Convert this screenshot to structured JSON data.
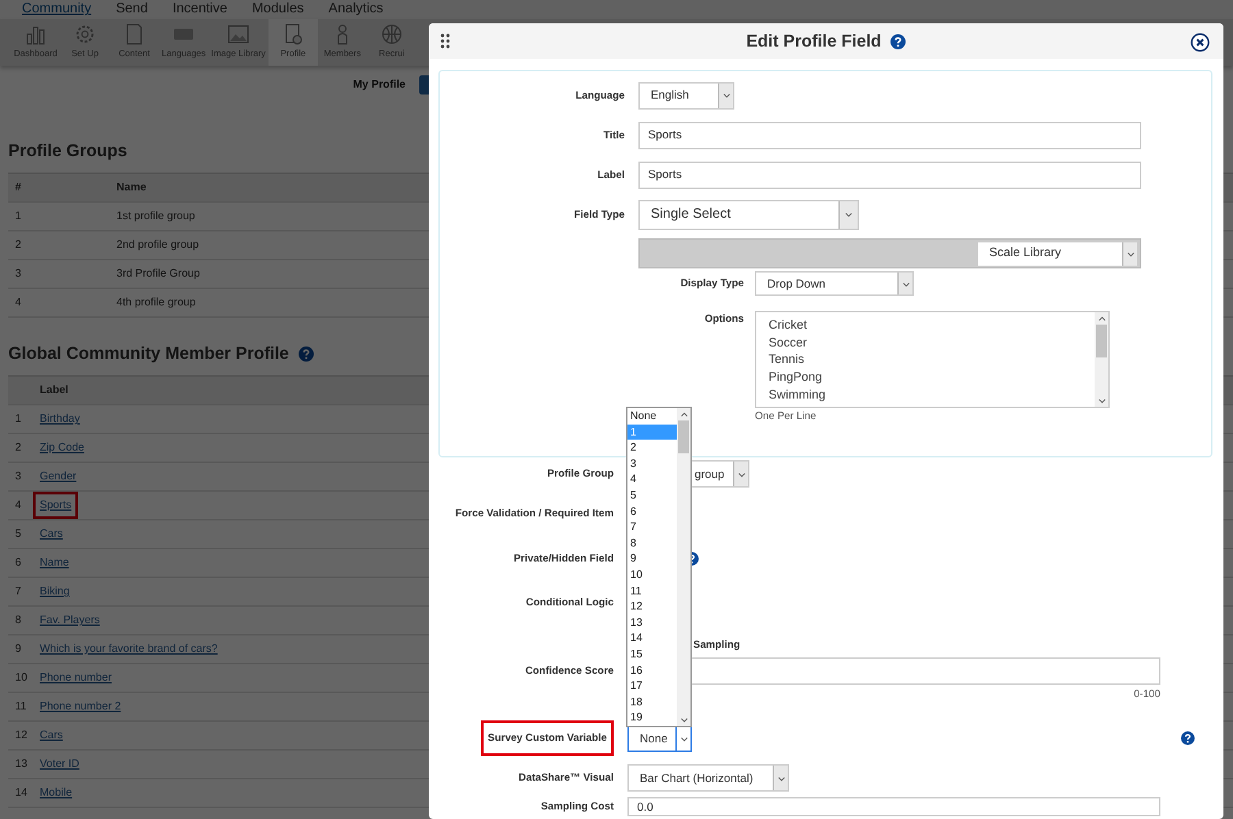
{
  "top_nav": [
    {
      "label": "Community",
      "selected": true
    },
    {
      "label": "Send",
      "selected": false
    },
    {
      "label": "Incentive",
      "selected": false
    },
    {
      "label": "Modules",
      "selected": false
    },
    {
      "label": "Analytics",
      "selected": false
    }
  ],
  "toolbar": [
    {
      "label": "Dashboard",
      "selected": false
    },
    {
      "label": "Set Up",
      "selected": false
    },
    {
      "label": "Content",
      "selected": false
    },
    {
      "label": "Languages",
      "selected": false
    },
    {
      "label": "Image Library",
      "selected": false
    },
    {
      "label": "Profile",
      "selected": true
    },
    {
      "label": "Members",
      "selected": false
    },
    {
      "label": "Recrui",
      "selected": false
    }
  ],
  "my_profile": "My Profile",
  "profile_groups": {
    "title": "Profile Groups",
    "columns": [
      "#",
      "Name"
    ],
    "rows": [
      [
        "1",
        "1st profile group"
      ],
      [
        "2",
        "2nd profile group"
      ],
      [
        "3",
        "3rd Profile Group"
      ],
      [
        "4",
        "4th profile group"
      ]
    ]
  },
  "member_profile": {
    "title": "Global Community Member Profile",
    "columns": [
      "Label"
    ],
    "rows": [
      {
        "number": "1",
        "label": "Birthday",
        "highlighted": false
      },
      {
        "number": "2",
        "label": "Zip Code",
        "highlighted": false
      },
      {
        "number": "3",
        "label": "Gender",
        "highlighted": false
      },
      {
        "number": "4",
        "label": "Sports",
        "highlighted": true
      },
      {
        "number": "5",
        "label": "Cars",
        "highlighted": false
      },
      {
        "number": "6",
        "label": "Name",
        "highlighted": false
      },
      {
        "number": "7",
        "label": "Biking",
        "highlighted": false
      },
      {
        "number": "8",
        "label": "Fav. Players",
        "highlighted": false
      },
      {
        "number": "9",
        "label": "Which is your favorite brand of cars?",
        "highlighted": false
      },
      {
        "number": "10",
        "label": "Phone number",
        "highlighted": false
      },
      {
        "number": "11",
        "label": "Phone number 2",
        "highlighted": false
      },
      {
        "number": "12",
        "label": "Cars",
        "highlighted": false
      },
      {
        "number": "13",
        "label": "Voter ID",
        "highlighted": false
      },
      {
        "number": "14",
        "label": "Mobile",
        "highlighted": false
      }
    ]
  },
  "modal": {
    "title": "Edit Profile Field",
    "panel_fields": [
      {
        "kind": "select",
        "label": "Language",
        "value": "English"
      },
      {
        "kind": "input",
        "label": "Title",
        "value": "Sports"
      },
      {
        "kind": "input",
        "label": "Label",
        "value": "Sports"
      },
      {
        "kind": "big_select",
        "label": "Field Type",
        "value": "Single Select"
      },
      {
        "kind": "scale_bar",
        "value": "Scale Library"
      },
      {
        "kind": "sub_select",
        "label": "Display Type",
        "value": "Drop Down"
      },
      {
        "kind": "textarea",
        "label": "Options",
        "lines": [
          "Cricket",
          "Soccer",
          "Tennis",
          "PingPong",
          "Swimming"
        ]
      },
      {
        "kind": "hint",
        "text": "One Per Line"
      }
    ],
    "fields": [
      {
        "kind": "select",
        "label": "Profile Group",
        "value": "group"
      },
      {
        "kind": "empty",
        "label": "Force Validation / Required Item"
      },
      {
        "kind": "help",
        "label": "Private/Hidden Field"
      },
      {
        "kind": "empty",
        "label": "Conditional Logic"
      },
      {
        "kind": "caption",
        "text": "Sampling"
      },
      {
        "kind": "input",
        "label": "Confidence Score"
      },
      {
        "kind": "hint",
        "text": "0-100"
      },
      {
        "kind": "select",
        "label": "Survey Custom Variable",
        "value": "None",
        "highlighted": true,
        "focused": true,
        "help": true
      },
      {
        "kind": "select",
        "label": "DataShare™ Visual",
        "value": "Bar Chart (Horizontal)"
      },
      {
        "kind": "input",
        "label": "Sampling Cost",
        "value": "0.0"
      }
    ],
    "open_list": [
      {
        "label": "None",
        "selected": false
      },
      {
        "label": "1",
        "selected": true
      },
      {
        "label": "2",
        "selected": false
      },
      {
        "label": "3",
        "selected": false
      },
      {
        "label": "4",
        "selected": false
      },
      {
        "label": "5",
        "selected": false
      },
      {
        "label": "6",
        "selected": false
      },
      {
        "label": "7",
        "selected": false
      },
      {
        "label": "8",
        "selected": false
      },
      {
        "label": "9",
        "selected": false
      },
      {
        "label": "10",
        "selected": false
      },
      {
        "label": "11",
        "selected": false
      },
      {
        "label": "12",
        "selected": false
      },
      {
        "label": "13",
        "selected": false
      },
      {
        "label": "14",
        "selected": false
      },
      {
        "label": "15",
        "selected": false
      },
      {
        "label": "16",
        "selected": false
      },
      {
        "label": "17",
        "selected": false
      },
      {
        "label": "18",
        "selected": false
      },
      {
        "label": "19",
        "selected": false
      }
    ]
  }
}
